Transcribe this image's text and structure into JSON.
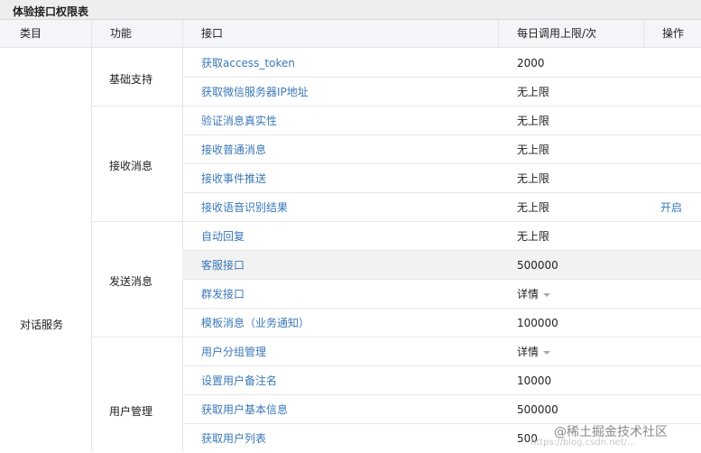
{
  "table_title": "体验接口权限表",
  "columns": {
    "category": "类目",
    "function": "功能",
    "api": "接口",
    "limit": "每日调用上限/次",
    "action": "操作"
  },
  "category": "对话服务",
  "groups": [
    {
      "name": "基础支持"
    },
    {
      "name": "接收消息"
    },
    {
      "name": "发送消息"
    },
    {
      "name": "用户管理"
    }
  ],
  "rows": [
    {
      "api": "获取access_token",
      "limit": "2000"
    },
    {
      "api": "获取微信服务器IP地址",
      "limit": "无上限"
    },
    {
      "api": "验证消息真实性",
      "limit": "无上限"
    },
    {
      "api": "接收普通消息",
      "limit": "无上限"
    },
    {
      "api": "接收事件推送",
      "limit": "无上限"
    },
    {
      "api": "接收语音识别结果",
      "limit": "无上限",
      "action": "开启"
    },
    {
      "api": "自动回复",
      "limit": "无上限"
    },
    {
      "api": "客服接口",
      "limit": "500000"
    },
    {
      "api": "群发接口",
      "limit": "详情"
    },
    {
      "api": "模板消息（业务通知）",
      "limit": "100000"
    },
    {
      "api": "用户分组管理",
      "limit": "详情"
    },
    {
      "api": "设置用户备注名",
      "limit": "10000"
    },
    {
      "api": "获取用户基本信息",
      "limit": "500000"
    },
    {
      "api": "获取用户列表",
      "limit": "500"
    }
  ],
  "watermark": "@稀土掘金技术社区",
  "watermark_small": "https://blog.csdn.net/..."
}
